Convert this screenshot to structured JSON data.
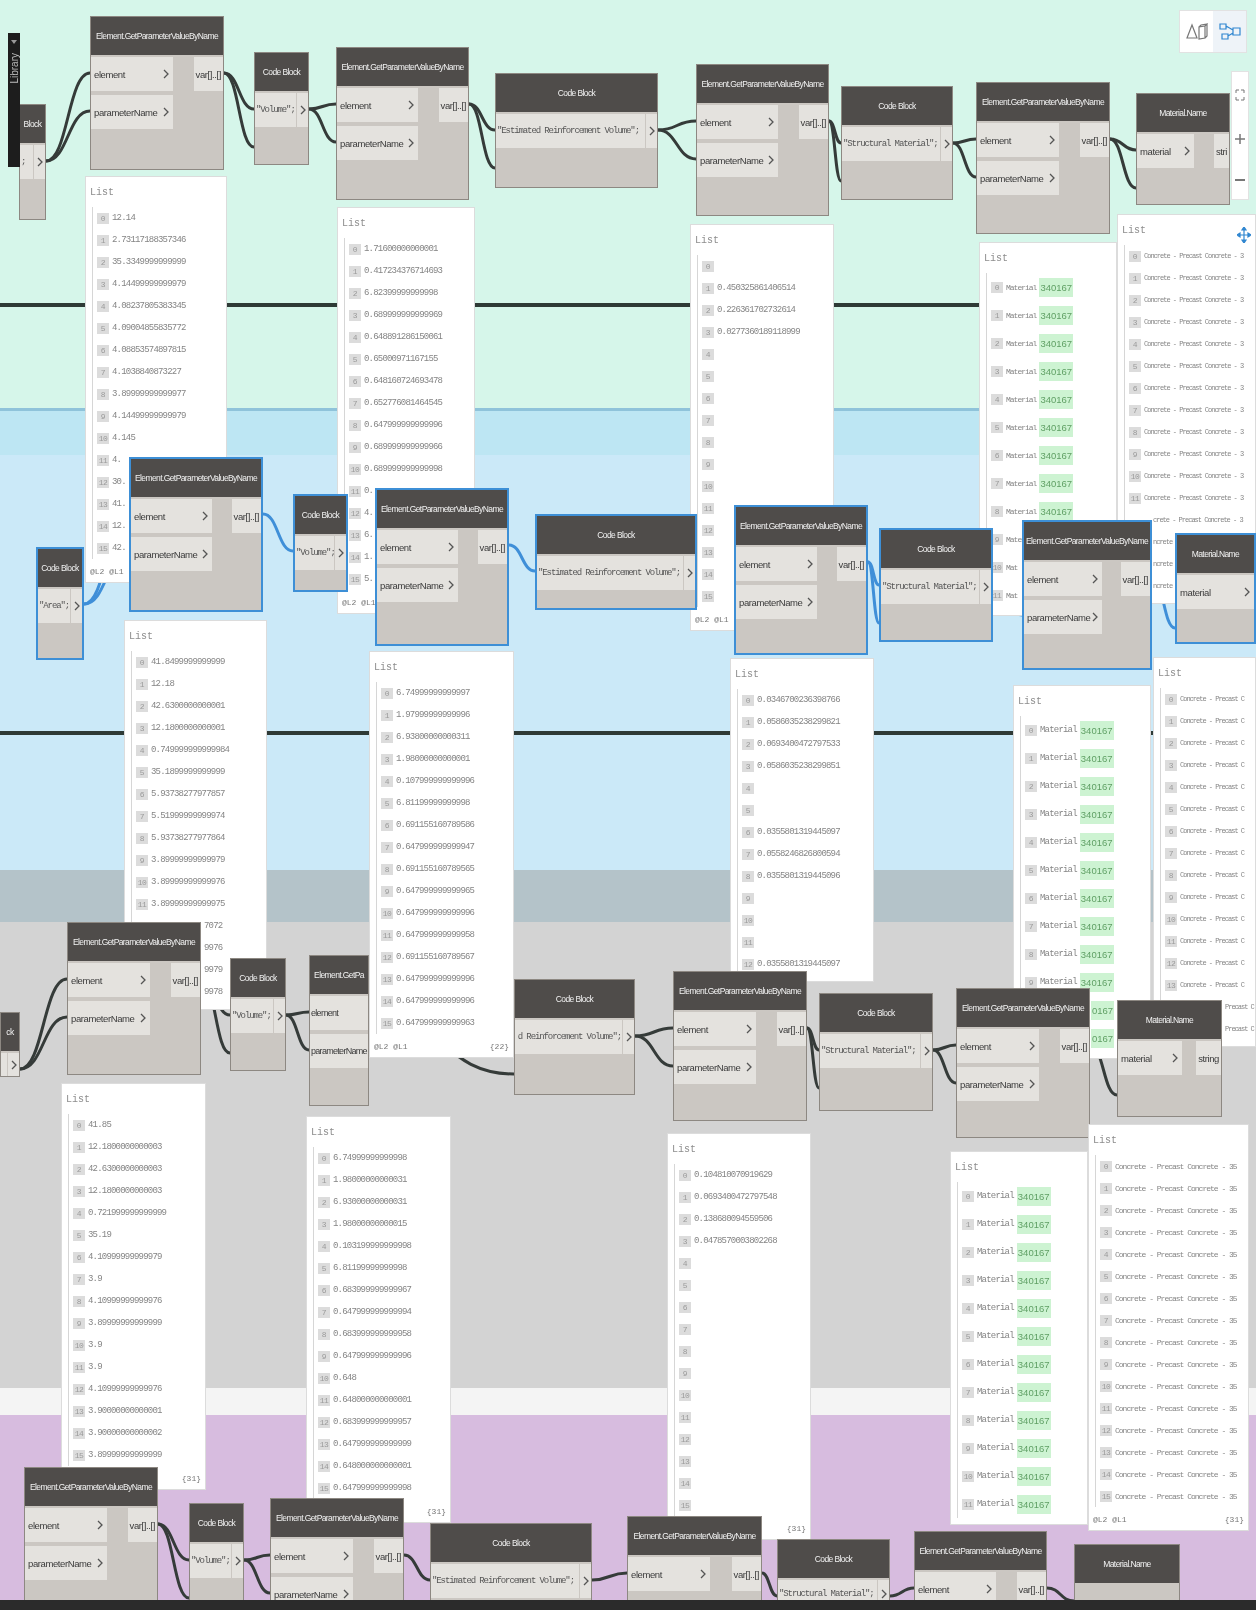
{
  "library_tab": {
    "label": "Library"
  },
  "view_toggle": [
    {
      "kind": "geometry",
      "selected": false
    },
    {
      "kind": "graph",
      "selected": true
    }
  ],
  "nodes": [
    {
      "kind": "code_block",
      "title": "Block",
      "code": ";",
      "selected": false
    },
    {
      "kind": "get_parameter",
      "title": "Element.GetParameterValueByName",
      "inputs": [
        "element",
        "parameterName"
      ],
      "output": "var[]..[]",
      "selected": false
    },
    {
      "kind": "code_block",
      "title": "Code Block",
      "code": "\"Volume\";",
      "selected": false
    },
    {
      "kind": "get_parameter",
      "title": "Element.GetParameterValueByName",
      "inputs": [
        "element",
        "parameterName"
      ],
      "output": "var[]..[]",
      "selected": false
    },
    {
      "kind": "code_block",
      "title": "Code Block",
      "code": "\"Estimated Reinforcement Volume\";",
      "selected": false
    },
    {
      "kind": "get_parameter",
      "title": "Element.GetParameterValueByName",
      "inputs": [
        "element",
        "parameterName"
      ],
      "output": "var[]..[]",
      "selected": false
    },
    {
      "kind": "code_block",
      "title": "Code Block",
      "code": "\"Structural Material\";",
      "selected": false
    },
    {
      "kind": "get_parameter",
      "title": "Element.GetParameterValueByName",
      "inputs": [
        "element",
        "parameterName"
      ],
      "output": "var[]..[]",
      "selected": false
    },
    {
      "kind": "material_name",
      "title": "Material.Name",
      "inputs": [
        "material"
      ],
      "output": "stri",
      "selected": false
    },
    {
      "kind": "code_block",
      "title": "Code Block",
      "code": "\"Area\";",
      "selected": true
    },
    {
      "kind": "get_parameter",
      "title": "Element.GetParameterValueByName",
      "inputs": [
        "element",
        "parameterName"
      ],
      "output": "var[]..[]",
      "selected": true
    },
    {
      "kind": "code_block",
      "title": "Code Block",
      "code": "\"Volume\";",
      "selected": true
    },
    {
      "kind": "get_parameter",
      "title": "Element.GetParameterValueByName",
      "inputs": [
        "element",
        "parameterName"
      ],
      "output": "var[]..[]",
      "selected": true
    },
    {
      "kind": "code_block",
      "title": "Code Block",
      "code": "\"Estimated Reinforcement Volume\";",
      "selected": true
    },
    {
      "kind": "get_parameter",
      "title": "Element.GetParameterValueByName",
      "inputs": [
        "element",
        "parameterName"
      ],
      "output": "var[]..[]",
      "selected": true
    },
    {
      "kind": "code_block",
      "title": "Code Block",
      "code": "\"Structural Material\";",
      "selected": true
    },
    {
      "kind": "get_parameter",
      "title": "Element.GetParameterValueByName",
      "inputs": [
        "element",
        "parameterName"
      ],
      "output": "var[]..[]",
      "selected": true
    },
    {
      "kind": "material_name",
      "title": "Material.Name",
      "inputs": [
        "material"
      ],
      "selected": true
    },
    {
      "kind": "code_block",
      "title": "ck",
      "selected": false
    },
    {
      "kind": "get_parameter",
      "title": "Element.GetParameterValueByName",
      "inputs": [
        "element",
        "parameterName"
      ],
      "output": "var[]..[]",
      "selected": false
    },
    {
      "kind": "code_block",
      "title": "Code Block",
      "code": "\"Volume\";",
      "selected": false
    },
    {
      "kind": "get_parameter",
      "title": "Element.GetPa",
      "inputs": [
        "element",
        "parameterName"
      ],
      "selected": false
    },
    {
      "kind": "code_block",
      "title": "Code Block",
      "code": "d Reinforcement Volume\";",
      "selected": false
    },
    {
      "kind": "get_parameter",
      "title": "Element.GetParameterValueByName",
      "inputs": [
        "element",
        "parameterName"
      ],
      "output": "var[]..[]",
      "selected": false
    },
    {
      "kind": "code_block",
      "title": "Code Block",
      "code": "\"Structural Material\";",
      "selected": false
    },
    {
      "kind": "get_parameter",
      "title": "Element.GetParameterValueByName",
      "inputs": [
        "element",
        "parameterName"
      ],
      "output": "var[]..[]",
      "selected": false
    },
    {
      "kind": "material_name",
      "title": "Material.Name",
      "inputs": [
        "material"
      ],
      "output": "string",
      "selected": false
    },
    {
      "kind": "get_parameter",
      "title": "Element.GetParameterValueByName",
      "inputs": [
        "element",
        "parameterName"
      ],
      "output": "var[]..[]",
      "selected": false
    },
    {
      "kind": "code_block",
      "title": "Code Block",
      "code": "\"Volume\";",
      "selected": false
    },
    {
      "kind": "get_parameter",
      "title": "Element.GetParameterValueByName",
      "inputs": [
        "element",
        "parameterName"
      ],
      "output": "var[]..[]",
      "selected": false
    },
    {
      "kind": "code_block",
      "title": "Code Block",
      "code": "\"Estimated Reinforcement Volume\";",
      "selected": false
    },
    {
      "kind": "get_parameter",
      "title": "Element.GetParameterValueByName",
      "inputs": [
        "element"
      ],
      "output": "var[]..[]",
      "selected": false
    },
    {
      "kind": "code_block",
      "title": "Code Block",
      "code": "\"Structural Material\";",
      "selected": false
    },
    {
      "kind": "get_parameter",
      "title": "Element.GetParameterValueByName",
      "inputs": [
        "element"
      ],
      "output": "var[]..[]",
      "selected": false
    },
    {
      "kind": "material_name",
      "title": "Material.Name",
      "selected": false
    }
  ],
  "previews": [
    {
      "header": "List",
      "rows": [
        {
          "index": "0",
          "value": "12.14"
        },
        {
          "index": "1",
          "value": "2.73117188357346"
        },
        {
          "index": "2",
          "value": "35.3349999999999"
        },
        {
          "index": "3",
          "value": "4.14499999999979"
        },
        {
          "index": "4",
          "value": "4.08237805383345"
        },
        {
          "index": "5",
          "value": "4.09004855835772"
        },
        {
          "index": "6",
          "value": "4.08853574897815"
        },
        {
          "index": "7",
          "value": "4.1038840873227"
        },
        {
          "index": "8",
          "value": "3.89999999999977"
        },
        {
          "index": "9",
          "value": "4.14499999999979"
        },
        {
          "index": "10",
          "value": "4.145"
        },
        {
          "index": "11",
          "value": "4."
        },
        {
          "index": "12",
          "value": "30."
        },
        {
          "index": "13",
          "value": "41."
        },
        {
          "index": "14",
          "value": "12."
        },
        {
          "index": "15",
          "value": "42."
        }
      ],
      "levels": "@L2 @L1"
    },
    {
      "header": "List",
      "rows": [
        {
          "index": "0",
          "value": "1.71600000000001"
        },
        {
          "index": "1",
          "value": "0.417234376714693"
        },
        {
          "index": "2",
          "value": "6.82399999999998"
        },
        {
          "index": "3",
          "value": "0.689999999999969"
        },
        {
          "index": "4",
          "value": "0.648891286150061"
        },
        {
          "index": "5",
          "value": "0.65000971167155"
        },
        {
          "index": "6",
          "value": "0.648160724693478"
        },
        {
          "index": "7",
          "value": "0.652776081464545"
        },
        {
          "index": "8",
          "value": "0.647999999999996"
        },
        {
          "index": "9",
          "value": "0.689999999999966"
        },
        {
          "index": "10",
          "value": "0.689999999999998"
        },
        {
          "index": "11",
          "value": "0."
        },
        {
          "index": "12",
          "value": "4."
        },
        {
          "index": "13",
          "value": "6."
        },
        {
          "index": "14",
          "value": "1."
        },
        {
          "index": "15",
          "value": "5."
        }
      ],
      "levels": "@L2 @L1"
    },
    {
      "header": "List",
      "rows": [
        {
          "index": "0"
        },
        {
          "index": "1",
          "value": "0.450325861406514"
        },
        {
          "index": "2",
          "value": "0.226361702732614"
        },
        {
          "index": "3",
          "value": "0.0277360189118999"
        },
        {
          "index": "4"
        },
        {
          "index": "5"
        },
        {
          "index": "6"
        },
        {
          "index": "7"
        },
        {
          "index": "8"
        },
        {
          "index": "9"
        },
        {
          "index": "10"
        },
        {
          "index": "11"
        },
        {
          "index": "12"
        },
        {
          "index": "13"
        },
        {
          "index": "14"
        },
        {
          "index": "15"
        }
      ],
      "levels": "@L2 @L1"
    },
    {
      "header": "List",
      "rows": [
        {
          "index": "0",
          "value": "Material",
          "tag": "340167"
        },
        {
          "index": "1",
          "value": "Material",
          "tag": "340167"
        },
        {
          "index": "2",
          "value": "Material",
          "tag": "340167"
        },
        {
          "index": "3",
          "value": "Material",
          "tag": "340167"
        },
        {
          "index": "4",
          "value": "Material",
          "tag": "340167"
        },
        {
          "index": "5",
          "value": "Material",
          "tag": "340167"
        },
        {
          "index": "6",
          "value": "Material",
          "tag": "340167"
        },
        {
          "index": "7",
          "value": "Material",
          "tag": "340167"
        },
        {
          "index": "8",
          "value": "Material",
          "tag": "340167"
        },
        {
          "index": "9",
          "value": "Mate"
        },
        {
          "index": "10",
          "value": "Mat"
        },
        {
          "index": "11",
          "value": "Mat"
        }
      ]
    },
    {
      "header": "List",
      "rows": [
        {
          "index": "0",
          "value": "Concrete - Precast Concrete - 3"
        },
        {
          "index": "1",
          "value": "Concrete - Precast Concrete - 3"
        },
        {
          "index": "2",
          "value": "Concrete - Precast Concrete - 3"
        },
        {
          "index": "3",
          "value": "Concrete - Precast Concrete - 3"
        },
        {
          "index": "4",
          "value": "Concrete - Precast Concrete - 3"
        },
        {
          "index": "5",
          "value": "Concrete - Precast Concrete - 3"
        },
        {
          "index": "6",
          "value": "Concrete - Precast Concrete - 3"
        },
        {
          "index": "7",
          "value": "Concrete - Precast Concrete - 3"
        },
        {
          "index": "8",
          "value": "Concrete - Precast Concrete - 3"
        },
        {
          "index": "9",
          "value": "Concrete - Precast Concrete - 3"
        },
        {
          "index": "10",
          "value": "Concrete - Precast Concrete - 3"
        },
        {
          "index": "11",
          "value": "Concrete - Precast Concrete - 3"
        },
        {
          "value": "crete - Precast Concrete - 3"
        },
        {
          "value": "ncrete"
        },
        {
          "value": "ncrete"
        },
        {
          "value": "ncrete"
        }
      ]
    },
    {
      "header": "List",
      "rows": [
        {
          "index": "0",
          "value": "41.8499999999999"
        },
        {
          "index": "1",
          "value": "12.18"
        },
        {
          "index": "2",
          "value": "42.6300000000001"
        },
        {
          "index": "3",
          "value": "12.1800000000001"
        },
        {
          "index": "4",
          "value": "0.749999999999984"
        },
        {
          "index": "5",
          "value": "35.1899999999999"
        },
        {
          "index": "6",
          "value": "5.93738277977857"
        },
        {
          "index": "7",
          "value": "5.51999999999974"
        },
        {
          "index": "8",
          "value": "5.93738277977864"
        },
        {
          "index": "9",
          "value": "3.89999999999979"
        },
        {
          "index": "10",
          "value": "3.89999999999976"
        },
        {
          "index": "11",
          "value": "3.89999999999975"
        },
        {
          "value": "7072"
        },
        {
          "value": "9976"
        },
        {
          "value": "9979"
        },
        {
          "value": "9978"
        }
      ]
    },
    {
      "header": "List",
      "rows": [
        {
          "index": "0",
          "value": "6.74999999999997"
        },
        {
          "index": "1",
          "value": "1.97999999999996"
        },
        {
          "index": "2",
          "value": "6.93800000000311"
        },
        {
          "index": "3",
          "value": "1.98000000000001"
        },
        {
          "index": "4",
          "value": "0.107999999999996"
        },
        {
          "index": "5",
          "value": "6.81199999999998"
        },
        {
          "index": "6",
          "value": "0.691155160789586"
        },
        {
          "index": "7",
          "value": "0.647999999999947"
        },
        {
          "index": "8",
          "value": "0.691155160789565"
        },
        {
          "index": "9",
          "value": "0.647999999999965"
        },
        {
          "index": "10",
          "value": "0.647999999999996"
        },
        {
          "index": "11",
          "value": "0.647999999999958"
        },
        {
          "index": "12",
          "value": "0.691155160789567"
        },
        {
          "index": "13",
          "value": "0.647999999999996"
        },
        {
          "index": "14",
          "value": "0.647999999999996"
        },
        {
          "index": "15",
          "value": "0.647999999999963"
        }
      ],
      "levels": "@L2 @L1",
      "count": "{22}"
    },
    {
      "header": "List",
      "rows": [
        {
          "index": "0",
          "value": "0.0346700236398766"
        },
        {
          "index": "1",
          "value": "0.0586035238299821"
        },
        {
          "index": "2",
          "value": "0.0693400472797533"
        },
        {
          "index": "3",
          "value": "0.0586035238299851"
        },
        {
          "index": "4"
        },
        {
          "index": "5"
        },
        {
          "index": "6",
          "value": "0.0355801319445097"
        },
        {
          "index": "7",
          "value": "0.0558246826800594"
        },
        {
          "index": "8",
          "value": "0.0355801319445096"
        },
        {
          "index": "9"
        },
        {
          "index": "10"
        },
        {
          "index": "11"
        },
        {
          "index": "12",
          "value": "0.0355801319445097"
        }
      ]
    },
    {
      "header": "List",
      "rows": [
        {
          "index": "0",
          "value": "Material",
          "tag": "340167"
        },
        {
          "index": "1",
          "value": "Material",
          "tag": "340167"
        },
        {
          "index": "2",
          "value": "Material",
          "tag": "340167"
        },
        {
          "index": "3",
          "value": "Material",
          "tag": "340167"
        },
        {
          "index": "4",
          "value": "Material",
          "tag": "340167"
        },
        {
          "index": "5",
          "value": "Material",
          "tag": "340167"
        },
        {
          "index": "6",
          "value": "Material",
          "tag": "340167"
        },
        {
          "index": "7",
          "value": "Material",
          "tag": "340167"
        },
        {
          "index": "8",
          "value": "Material",
          "tag": "340167"
        },
        {
          "index": "9",
          "value": "Material",
          "tag": "340167"
        },
        {
          "tag": "0167"
        },
        {
          "tag": "0167"
        }
      ]
    },
    {
      "header": "List",
      "rows": [
        {
          "index": "0",
          "value": "Concrete - Precast C"
        },
        {
          "index": "1",
          "value": "Concrete - Precast C"
        },
        {
          "index": "2",
          "value": "Concrete - Precast C"
        },
        {
          "index": "3",
          "value": "Concrete - Precast C"
        },
        {
          "index": "4",
          "value": "Concrete - Precast C"
        },
        {
          "index": "5",
          "value": "Concrete - Precast C"
        },
        {
          "index": "6",
          "value": "Concrete - Precast C"
        },
        {
          "index": "7",
          "value": "Concrete - Precast C"
        },
        {
          "index": "8",
          "value": "Concrete - Precast C"
        },
        {
          "index": "9",
          "value": "Concrete - Precast C"
        },
        {
          "index": "10",
          "value": "Concrete - Precast C"
        },
        {
          "index": "11",
          "value": "Concrete - Precast C"
        },
        {
          "index": "12",
          "value": "Concrete - Precast C"
        },
        {
          "index": "13",
          "value": "Concrete - Precast C"
        },
        {
          "value": "Precast C"
        },
        {
          "value": "Precast C"
        }
      ]
    },
    {
      "header": "List",
      "rows": [
        {
          "index": "0",
          "value": "41.85"
        },
        {
          "index": "1",
          "value": "12.1800000000003"
        },
        {
          "index": "2",
          "value": "42.6300000000003"
        },
        {
          "index": "3",
          "value": "12.1800000000003"
        },
        {
          "index": "4",
          "value": "0.721999999999999"
        },
        {
          "index": "5",
          "value": "35.19"
        },
        {
          "index": "6",
          "value": "4.10999999999979"
        },
        {
          "index": "7",
          "value": "3.9"
        },
        {
          "index": "8",
          "value": "4.10999999999976"
        },
        {
          "index": "9",
          "value": "3.89999999999999"
        },
        {
          "index": "10",
          "value": "3.9"
        },
        {
          "index": "11",
          "value": "3.9"
        },
        {
          "index": "12",
          "value": "4.10999999999976"
        },
        {
          "index": "13",
          "value": "3.90000000000001"
        },
        {
          "index": "14",
          "value": "3.90000000000002"
        },
        {
          "index": "15",
          "value": "3.89999999999999"
        }
      ],
      "count": "{31}"
    },
    {
      "header": "List",
      "rows": [
        {
          "index": "0",
          "value": "6.74999999999998"
        },
        {
          "index": "1",
          "value": "1.98000000000031"
        },
        {
          "index": "2",
          "value": "6.93000000000031"
        },
        {
          "index": "3",
          "value": "1.98000000000015"
        },
        {
          "index": "4",
          "value": "0.103199999999998"
        },
        {
          "index": "5",
          "value": "6.81199999999998"
        },
        {
          "index": "6",
          "value": "0.683999999999967"
        },
        {
          "index": "7",
          "value": "0.647999999999994"
        },
        {
          "index": "8",
          "value": "0.683999999999958"
        },
        {
          "index": "9",
          "value": "0.647999999999996"
        },
        {
          "index": "10",
          "value": "0.648"
        },
        {
          "index": "11",
          "value": "0.648000000000001"
        },
        {
          "index": "12",
          "value": "0.683999999999957"
        },
        {
          "index": "13",
          "value": "0.647999999999999"
        },
        {
          "index": "14",
          "value": "0.648000000000001"
        },
        {
          "index": "15",
          "value": "0.647999999999998"
        }
      ],
      "count": "{31}"
    },
    {
      "header": "List",
      "rows": [
        {
          "index": "0",
          "value": "0.104810070919629"
        },
        {
          "index": "1",
          "value": "0.0693400472797548"
        },
        {
          "index": "2",
          "value": "0.138680094559506"
        },
        {
          "index": "3",
          "value": "0.0478570003802268"
        },
        {
          "index": "4"
        },
        {
          "index": "5"
        },
        {
          "index": "6"
        },
        {
          "index": "7"
        },
        {
          "index": "8"
        },
        {
          "index": "9"
        },
        {
          "index": "10"
        },
        {
          "index": "11"
        },
        {
          "index": "12"
        },
        {
          "index": "13"
        },
        {
          "index": "14"
        },
        {
          "index": "15"
        }
      ],
      "count": "{31}"
    },
    {
      "header": "List",
      "rows": [
        {
          "index": "0",
          "value": "Material",
          "tag": "340167"
        },
        {
          "index": "1",
          "value": "Material",
          "tag": "340167"
        },
        {
          "index": "2",
          "value": "Material",
          "tag": "340167"
        },
        {
          "index": "3",
          "value": "Material",
          "tag": "340167"
        },
        {
          "index": "4",
          "value": "Material",
          "tag": "340167"
        },
        {
          "index": "5",
          "value": "Material",
          "tag": "340167"
        },
        {
          "index": "6",
          "value": "Material",
          "tag": "340167"
        },
        {
          "index": "7",
          "value": "Material",
          "tag": "340167"
        },
        {
          "index": "8",
          "value": "Material",
          "tag": "340167"
        },
        {
          "index": "9",
          "value": "Material",
          "tag": "340167"
        },
        {
          "index": "10",
          "value": "Material",
          "tag": "340167"
        },
        {
          "index": "11",
          "value": "Material",
          "tag": "340167"
        }
      ]
    },
    {
      "header": "List",
      "rows": [
        {
          "index": "0",
          "value": "Concrete - Precast Concrete - 35"
        },
        {
          "index": "1",
          "value": "Concrete - Precast Concrete - 35"
        },
        {
          "index": "2",
          "value": "Concrete - Precast Concrete - 35"
        },
        {
          "index": "3",
          "value": "Concrete - Precast Concrete - 35"
        },
        {
          "index": "4",
          "value": "Concrete - Precast Concrete - 35"
        },
        {
          "index": "5",
          "value": "Concrete - Precast Concrete - 35"
        },
        {
          "index": "6",
          "value": "Concrete - Precast Concrete - 35"
        },
        {
          "index": "7",
          "value": "Concrete - Precast Concrete - 35"
        },
        {
          "index": "8",
          "value": "Concrete - Precast Concrete - 35"
        },
        {
          "index": "9",
          "value": "Concrete - Precast Concrete - 35"
        },
        {
          "index": "10",
          "value": "Concrete - Precast Concrete - 35"
        },
        {
          "index": "11",
          "value": "Concrete - Precast Concrete - 35"
        },
        {
          "index": "12",
          "value": "Concrete - Precast Concrete - 35"
        },
        {
          "index": "13",
          "value": "Concrete - Precast Concrete - 35"
        },
        {
          "index": "14",
          "value": "Concrete - Precast Concrete - 35"
        },
        {
          "index": "15",
          "value": "Concrete - Precast Concrete - 35"
        }
      ],
      "levels": "@L2 @L1",
      "count": "{31}"
    }
  ]
}
